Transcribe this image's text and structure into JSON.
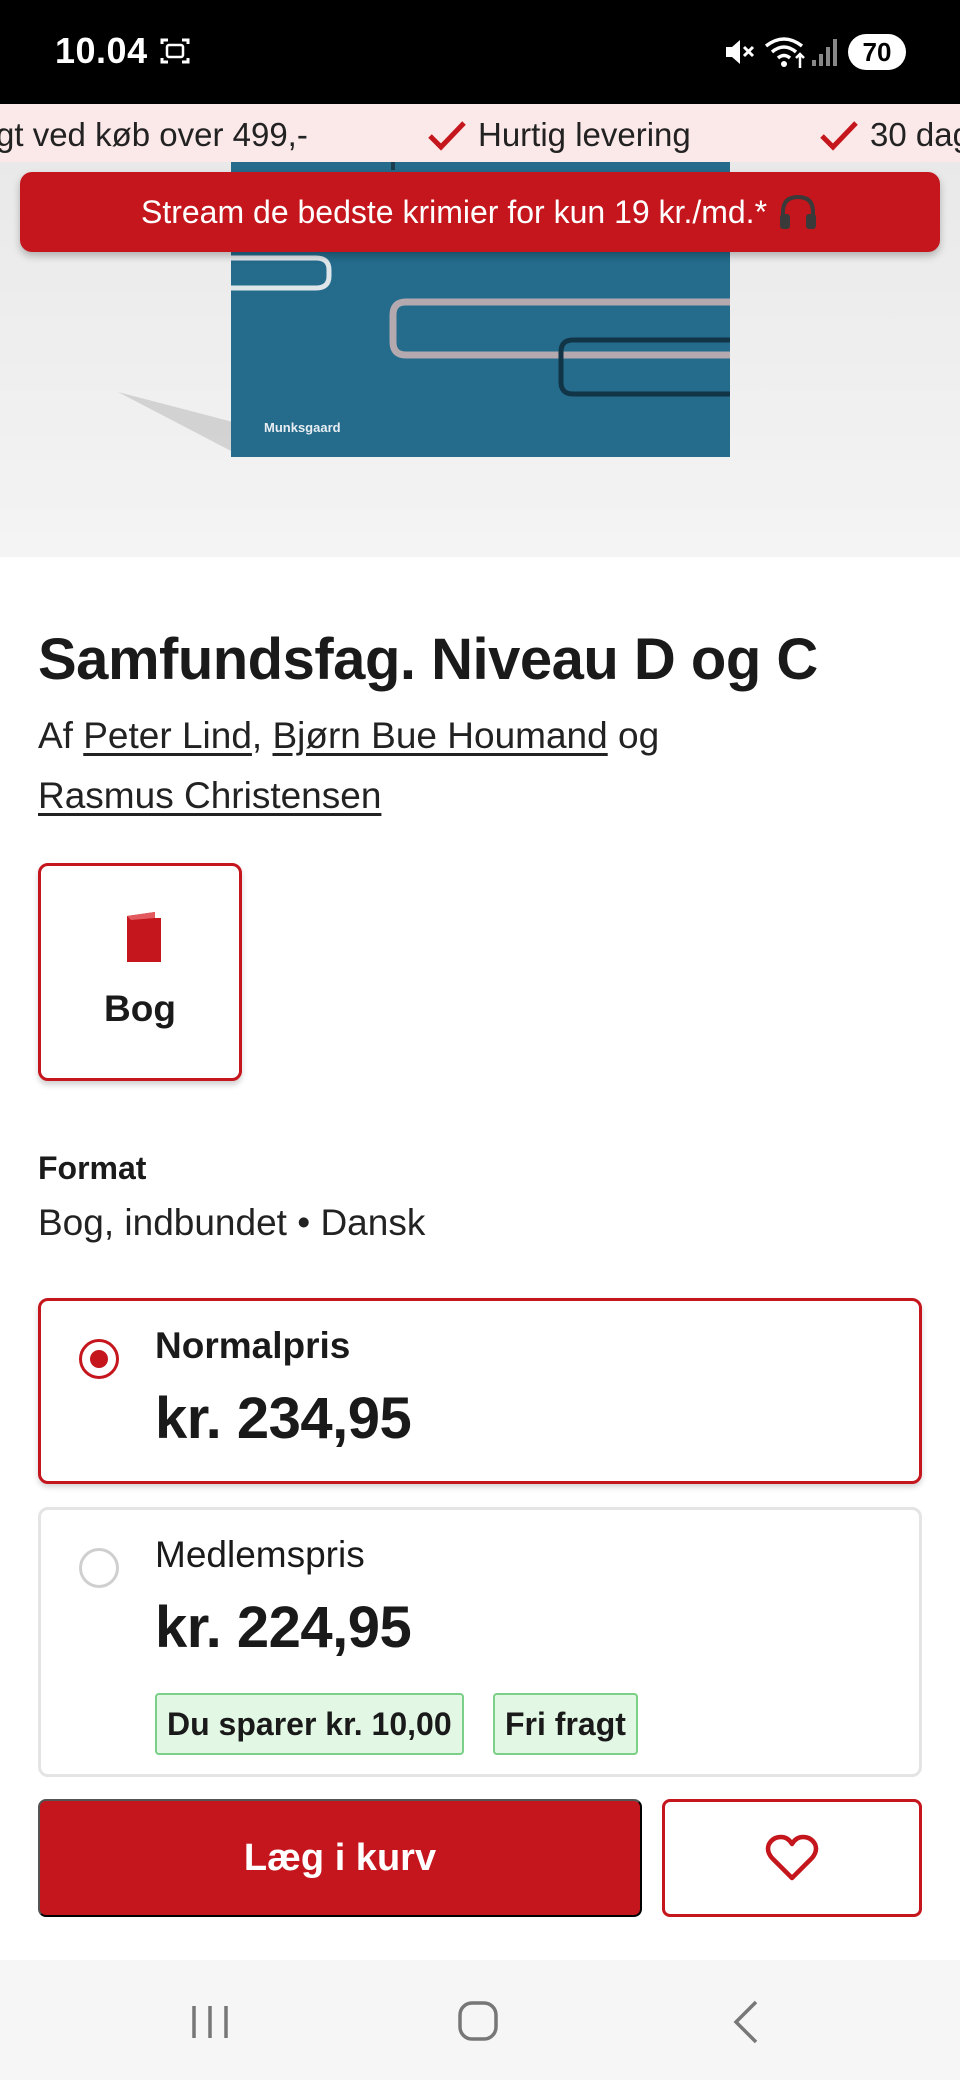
{
  "status_bar": {
    "time": "10.04",
    "battery": "70"
  },
  "usp_bar": {
    "items": [
      "gt ved køb over 499,-",
      "Hurtig levering",
      "30 dag"
    ]
  },
  "promo_banner": {
    "text": "Stream de bedste krimier for kun 19 kr./md.*"
  },
  "cover": {
    "publisher": "Munksgaard",
    "color": "#246b8c"
  },
  "product": {
    "title": "Samfundsfag. Niveau D og C",
    "authors_prefix": "Af",
    "authors": [
      "Peter Lind",
      "Bjørn Bue Houmand",
      "Rasmus Christensen"
    ],
    "authors_sep_1": ",",
    "authors_conj": "og"
  },
  "format_tile": {
    "label": "Bog",
    "icon": "book-icon"
  },
  "format": {
    "heading": "Format",
    "value": "Bog, indbundet  •  Dansk"
  },
  "prices": {
    "normal": {
      "label": "Normalpris",
      "value": "kr. 234,95",
      "selected": true
    },
    "member": {
      "label": "Medlemspris",
      "value": "kr. 224,95",
      "selected": false,
      "badges": [
        "Du sparer kr. 10,00",
        "Fri fragt"
      ]
    }
  },
  "actions": {
    "add_to_cart": "Læg i kurv",
    "favorite_icon": "heart-icon"
  },
  "colors": {
    "accent": "#c4161c",
    "usp_background": "#fbe8e8",
    "badge_background": "#e2f7e4"
  }
}
